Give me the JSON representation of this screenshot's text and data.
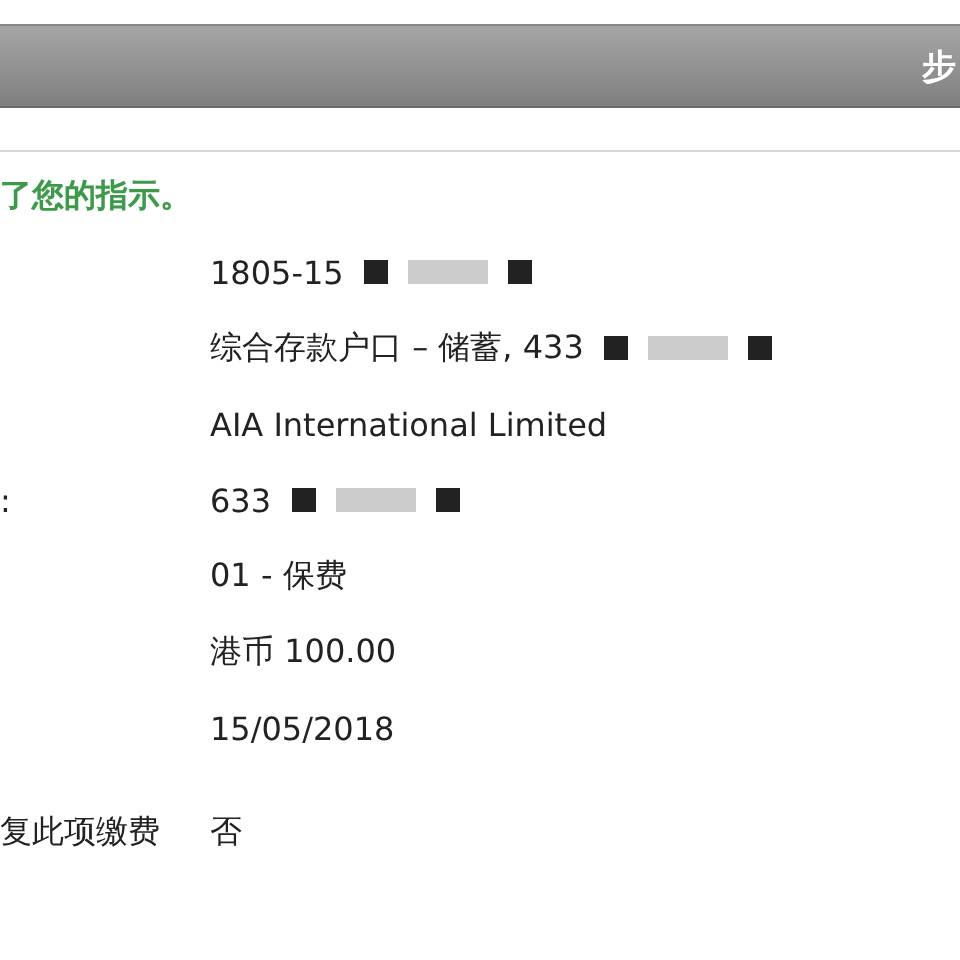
{
  "header": {
    "title": "步"
  },
  "message": "了您的指示。",
  "rows": [
    {
      "label": "",
      "value": "1805-15",
      "redacted": true
    },
    {
      "label": "",
      "value": "综合存款户口 – 储蓄, 433",
      "redacted": true
    },
    {
      "label": "",
      "value": "AIA International Limited",
      "redacted": false
    },
    {
      "label": ":",
      "value": "633",
      "redacted": true
    },
    {
      "label": "",
      "value": "01 - 保费",
      "redacted": false
    },
    {
      "label": "",
      "value": "港币  100.00",
      "redacted": false
    },
    {
      "label": "",
      "value": "15/05/2018",
      "redacted": false
    },
    {
      "label": "复此项缴费",
      "value": "否",
      "redacted": false
    }
  ]
}
